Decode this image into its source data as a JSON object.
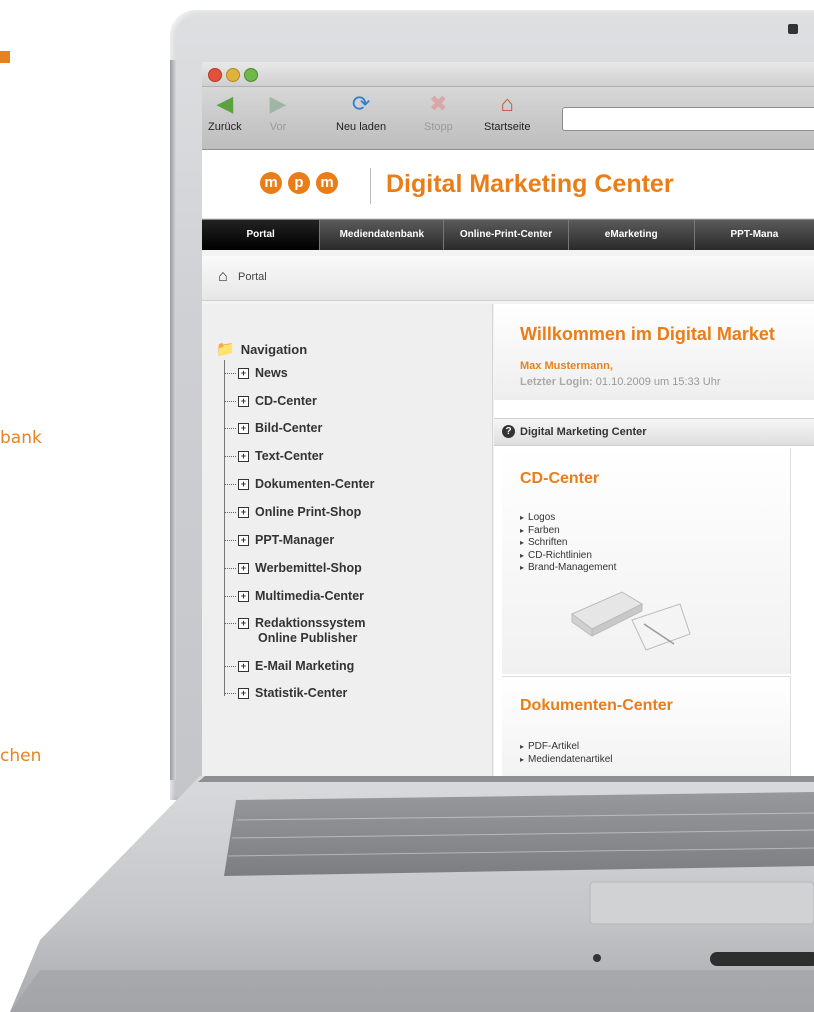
{
  "side_text": [
    "bank",
    "chen"
  ],
  "browser": {
    "toolbar": {
      "back": "Zurück",
      "forward": "Vor",
      "reload": "Neu laden",
      "stop": "Stopp",
      "home": "Startseite"
    }
  },
  "site": {
    "brand_letters": [
      "m",
      "p",
      "m"
    ],
    "title": "Digital Marketing Center",
    "nav": [
      "Portal",
      "Mediendatenbank",
      "Online-Print-Center",
      "eMarketing",
      "PPT-Mana"
    ],
    "breadcrumb": "Portal",
    "sidebar": {
      "heading": "Navigation",
      "items": [
        "News",
        "CD-Center",
        "Bild-Center",
        "Text-Center",
        "Dokumenten-Center",
        "Online Print-Shop",
        "PPT-Manager",
        "Werbemittel-Shop",
        "Multimedia-Center",
        "Redaktionssystem",
        "Online Publisher",
        "E-Mail Marketing",
        "Statistik-Center"
      ]
    },
    "welcome": {
      "title": "Willkommen im Digital Market",
      "user": "Max Mustermann,",
      "login_label": "Letzter Login:",
      "login_value": "01.10.2009 um 15:33 Uhr"
    },
    "section_title": "Digital Marketing Center",
    "cards": [
      {
        "title": "CD-Center",
        "items": [
          "Logos",
          "Farben",
          "Schriften",
          "CD-Richtlinien",
          "Brand-Management"
        ]
      },
      {
        "title": "Dokumenten-Center",
        "items": [
          "PDF-Artikel",
          "Mediendatenartikel"
        ]
      }
    ]
  },
  "colors": {
    "accent": "#ea7d17"
  }
}
